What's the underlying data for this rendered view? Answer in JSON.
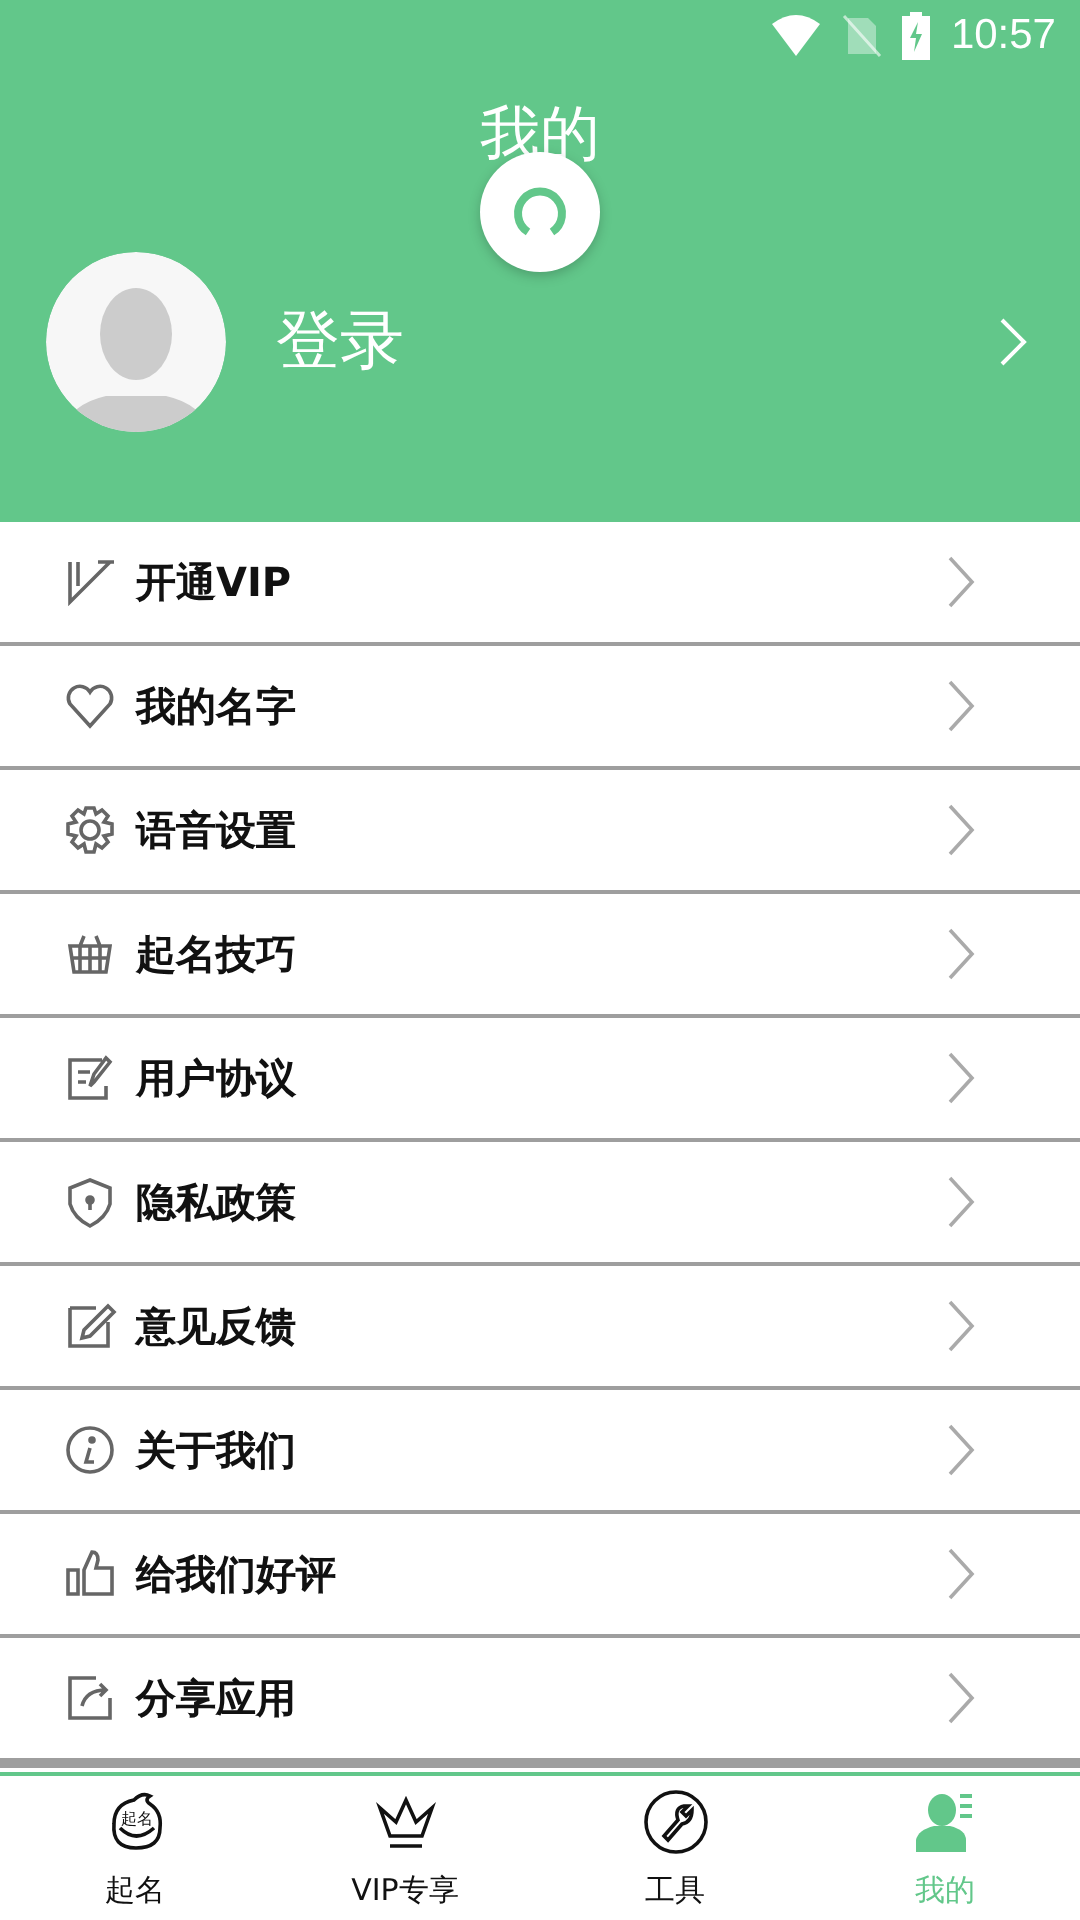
{
  "status_bar": {
    "time": "10:57"
  },
  "header": {
    "title": "我的",
    "login_label": "登录"
  },
  "menu": [
    {
      "label": "开通VIP"
    },
    {
      "label": "我的名字"
    },
    {
      "label": "语音设置"
    },
    {
      "label": "起名技巧"
    },
    {
      "label": "用户协议"
    },
    {
      "label": "隐私政策"
    },
    {
      "label": "意见反馈"
    },
    {
      "label": "关于我们"
    },
    {
      "label": "给我们好评"
    },
    {
      "label": "分享应用"
    }
  ],
  "tabs": [
    {
      "label": "起名",
      "icon_text": "起名",
      "selected": false
    },
    {
      "label": "VIP专享",
      "selected": false
    },
    {
      "label": "工具",
      "selected": false
    },
    {
      "label": "我的",
      "selected": true
    }
  ]
}
